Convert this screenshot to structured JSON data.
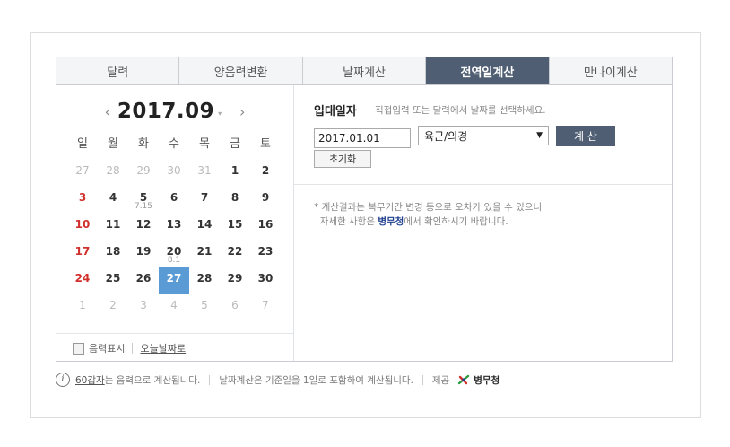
{
  "tabs": [
    "달력",
    "양음력변환",
    "날짜계산",
    "전역일계산",
    "만나이계산"
  ],
  "active_tab": 3,
  "calendar": {
    "prev_icon": "‹",
    "next_icon": "›",
    "caret": "▾",
    "year_month": "2017.09",
    "weekdays": [
      "일",
      "월",
      "화",
      "수",
      "목",
      "금",
      "토"
    ],
    "days": [
      {
        "d": "27",
        "muted": true
      },
      {
        "d": "28",
        "muted": true
      },
      {
        "d": "29",
        "muted": true
      },
      {
        "d": "30",
        "muted": true
      },
      {
        "d": "31",
        "muted": true
      },
      {
        "d": "1"
      },
      {
        "d": "2"
      },
      {
        "d": "3",
        "sun": true
      },
      {
        "d": "4"
      },
      {
        "d": "5",
        "sub": "7.15"
      },
      {
        "d": "6"
      },
      {
        "d": "7"
      },
      {
        "d": "8"
      },
      {
        "d": "9"
      },
      {
        "d": "10",
        "sun": true
      },
      {
        "d": "11"
      },
      {
        "d": "12"
      },
      {
        "d": "13"
      },
      {
        "d": "14"
      },
      {
        "d": "15"
      },
      {
        "d": "16"
      },
      {
        "d": "17",
        "sun": true
      },
      {
        "d": "18"
      },
      {
        "d": "19"
      },
      {
        "d": "20",
        "sub": "8.1"
      },
      {
        "d": "21"
      },
      {
        "d": "22"
      },
      {
        "d": "23"
      },
      {
        "d": "24",
        "sun": true
      },
      {
        "d": "25"
      },
      {
        "d": "26"
      },
      {
        "d": "27",
        "sel": true
      },
      {
        "d": "28"
      },
      {
        "d": "29"
      },
      {
        "d": "30"
      },
      {
        "d": "1",
        "muted": true
      },
      {
        "d": "2",
        "muted": true
      },
      {
        "d": "3",
        "muted": true
      },
      {
        "d": "4",
        "muted": true
      },
      {
        "d": "5",
        "muted": true
      },
      {
        "d": "6",
        "muted": true
      },
      {
        "d": "7",
        "muted": true
      }
    ],
    "lunar_label": "음력표시",
    "today_label": "오늘날짜로"
  },
  "form": {
    "label": "입대일자",
    "hint": "직접입력 또는 달력에서 날짜를 선택하세요.",
    "date_value": "2017.01.01",
    "branch": "육군/의경",
    "select_arrow": "▼",
    "calc_label": "계 산",
    "reset_label": "초기화"
  },
  "notice": {
    "line1": "* 계산결과는 복무기간 변경 등으로 오차가 있을 수 있으니",
    "line2_pre": "자세한 사항은 ",
    "line2_link": "병무청",
    "line2_post": "에서 확인하시기 바랍니다."
  },
  "footer": {
    "info_icon": "i",
    "link": "60갑자",
    "text1": "는 음력으로 계산됩니다.",
    "text2": "날짜계산은 기준일을 1일로 포함하여 계산됩니다.",
    "provider_label": "제공",
    "provider_name": "병무청"
  },
  "colors": {
    "active_tab": "#4f5e73",
    "selected_day": "#5b9bd5",
    "sunday": "#d0312d",
    "link": "#1f3f8f"
  }
}
